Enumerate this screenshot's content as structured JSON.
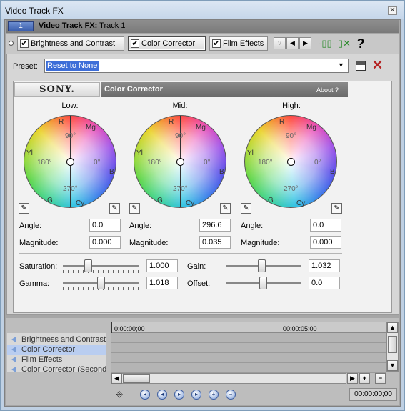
{
  "window": {
    "title": "Video Track FX",
    "close": "✕"
  },
  "track": {
    "number": "1",
    "label_bold": "Video Track FX:",
    "label_rest": " Track 1"
  },
  "chain": {
    "items": [
      {
        "label": "Brightness and Contrast",
        "checked": true
      },
      {
        "label": "Color Corrector",
        "checked": true
      },
      {
        "label": "Film Effects",
        "checked": true
      }
    ],
    "help": "?"
  },
  "preset": {
    "label": "Preset:",
    "value": "Reset to None"
  },
  "plugin": {
    "brand": "SONY.",
    "title": "Color Corrector",
    "about": "About  ?",
    "wheels": [
      {
        "name": "Low:",
        "angle": "0.0",
        "magnitude": "0.000"
      },
      {
        "name": "Mid:",
        "angle": "296.6",
        "magnitude": "0.035"
      },
      {
        "name": "High:",
        "angle": "0.0",
        "magnitude": "0.000"
      }
    ],
    "wheel_labels": {
      "r": "R",
      "mg": "Mg",
      "yl": "Yl",
      "b": "B",
      "g": "G",
      "cy": "Cy",
      "d90": "90°",
      "d180": "180°",
      "d0": "0°",
      "d270": "270°"
    },
    "angle_label": "Angle:",
    "magnitude_label": "Magnitude:",
    "saturation": {
      "label": "Saturation:",
      "value": "1.000"
    },
    "gamma": {
      "label": "Gamma:",
      "value": "1.018"
    },
    "gain": {
      "label": "Gain:",
      "value": "1.032"
    },
    "offset": {
      "label": "Offset:",
      "value": "0.0"
    }
  },
  "timeline": {
    "fx_list": [
      "Brightness and Contrast",
      "Color Corrector",
      "Film Effects",
      "Color Corrector (Second"
    ],
    "selected_index": 1,
    "ruler": [
      "0:00:00;00",
      "00:00:05;00"
    ],
    "timecode": "00:00:00;00"
  },
  "colors": {
    "accent": "#3d6ed8",
    "selection": "#b9cdf0"
  }
}
